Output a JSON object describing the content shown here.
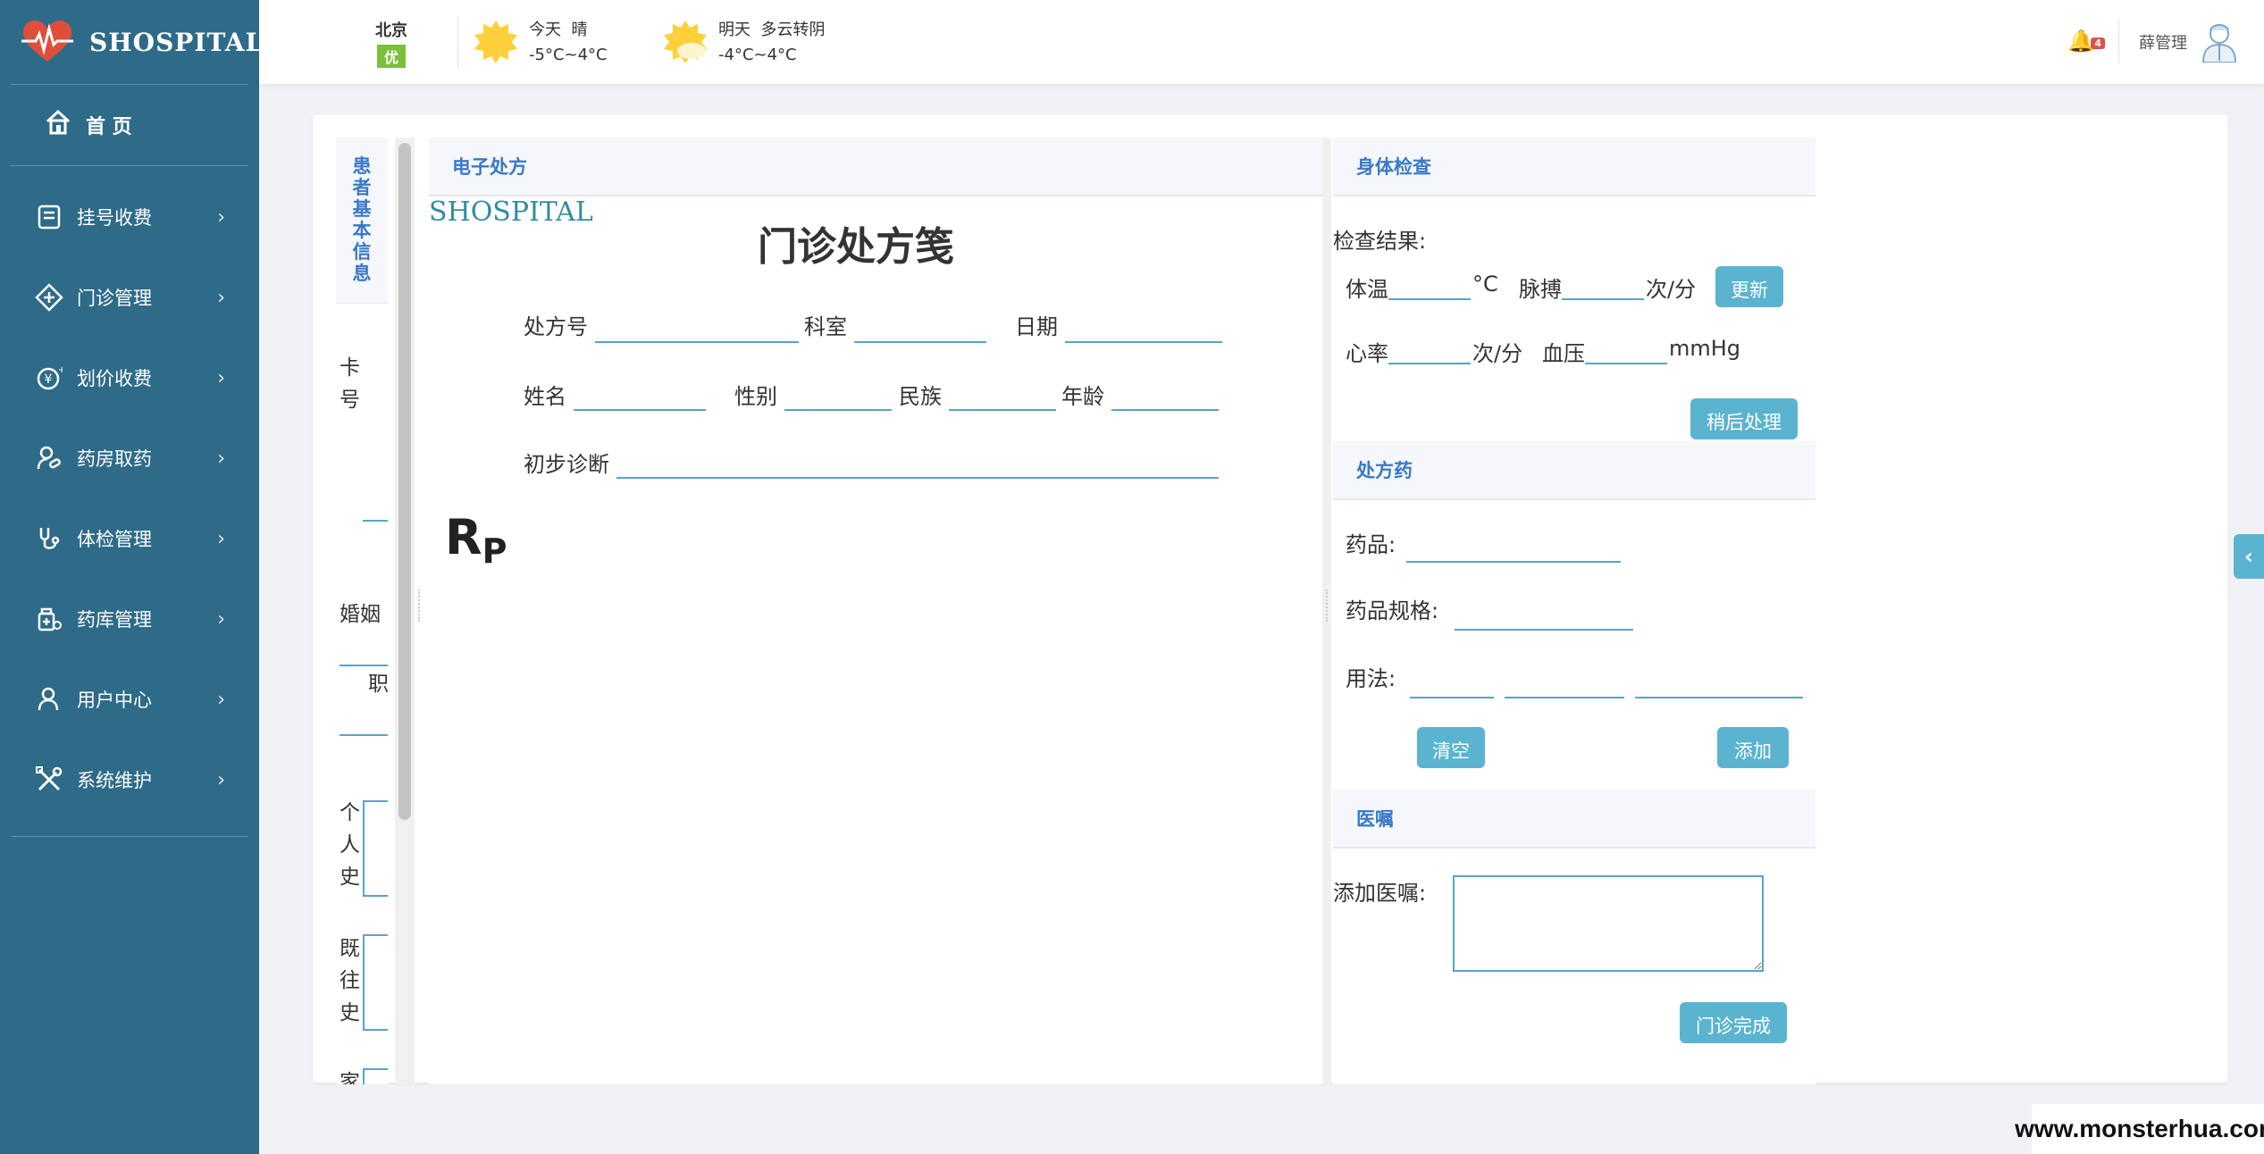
{
  "app": {
    "name": "SHOSPITAL"
  },
  "sidebar": {
    "home": "首 页",
    "items": [
      {
        "label": "挂号收费",
        "icon": "register-icon"
      },
      {
        "label": "门诊管理",
        "icon": "clinic-icon"
      },
      {
        "label": "划价收费",
        "icon": "yuan-icon"
      },
      {
        "label": "药房取药",
        "icon": "pharmacy-icon"
      },
      {
        "label": "体检管理",
        "icon": "stethoscope-icon"
      },
      {
        "label": "药库管理",
        "icon": "warehouse-icon"
      },
      {
        "label": "用户中心",
        "icon": "user-icon"
      },
      {
        "label": "系统维护",
        "icon": "tools-icon"
      }
    ]
  },
  "header": {
    "city": "北京",
    "air_quality": "优",
    "today": {
      "label": "今天",
      "condition": "晴",
      "temp": "-5°C~4°C"
    },
    "tomorrow": {
      "label": "明天",
      "condition": "多云转阴",
      "temp": "-4°C~4°C"
    },
    "notification_count": "4",
    "user_name": "薛管理"
  },
  "patient": {
    "title": "患者基本信息",
    "fields": {
      "card_no": "卡号",
      "marriage": "婚姻",
      "job": "职",
      "personal_history": "个人史",
      "past_history": "既往史",
      "family": "家"
    }
  },
  "prescription": {
    "section_title": "电子处方",
    "brand": "SHOSPITAL",
    "title": "门诊处方笺",
    "fields": {
      "rx_no": "处方号",
      "dept": "科室",
      "date": "日期",
      "name": "姓名",
      "sex": "性别",
      "ethnicity": "民族",
      "age": "年龄",
      "diagnosis": "初步诊断"
    },
    "rp_main": "R",
    "rp_sub": "P"
  },
  "exam": {
    "section_title": "身体检查",
    "result_label": "检查结果:",
    "temp_label": "体温",
    "temp_unit": "°C",
    "pulse_label": "脉搏",
    "pulse_unit": "次/分",
    "hr_label": "心率",
    "hr_unit": "次/分",
    "bp_label": "血压",
    "bp_unit": "mmHg",
    "update_button": "更新",
    "later_button": "稍后处理"
  },
  "drugs": {
    "section_title": "处方药",
    "drug_label": "药品:",
    "spec_label": "药品规格:",
    "usage_label": "用法:",
    "clear_button": "清空",
    "add_button": "添加"
  },
  "advice": {
    "section_title": "医嘱",
    "add_label": "添加医嘱:",
    "note_value": "",
    "finish_button": "门诊完成"
  },
  "watermark": "www.monsterhua.com"
}
